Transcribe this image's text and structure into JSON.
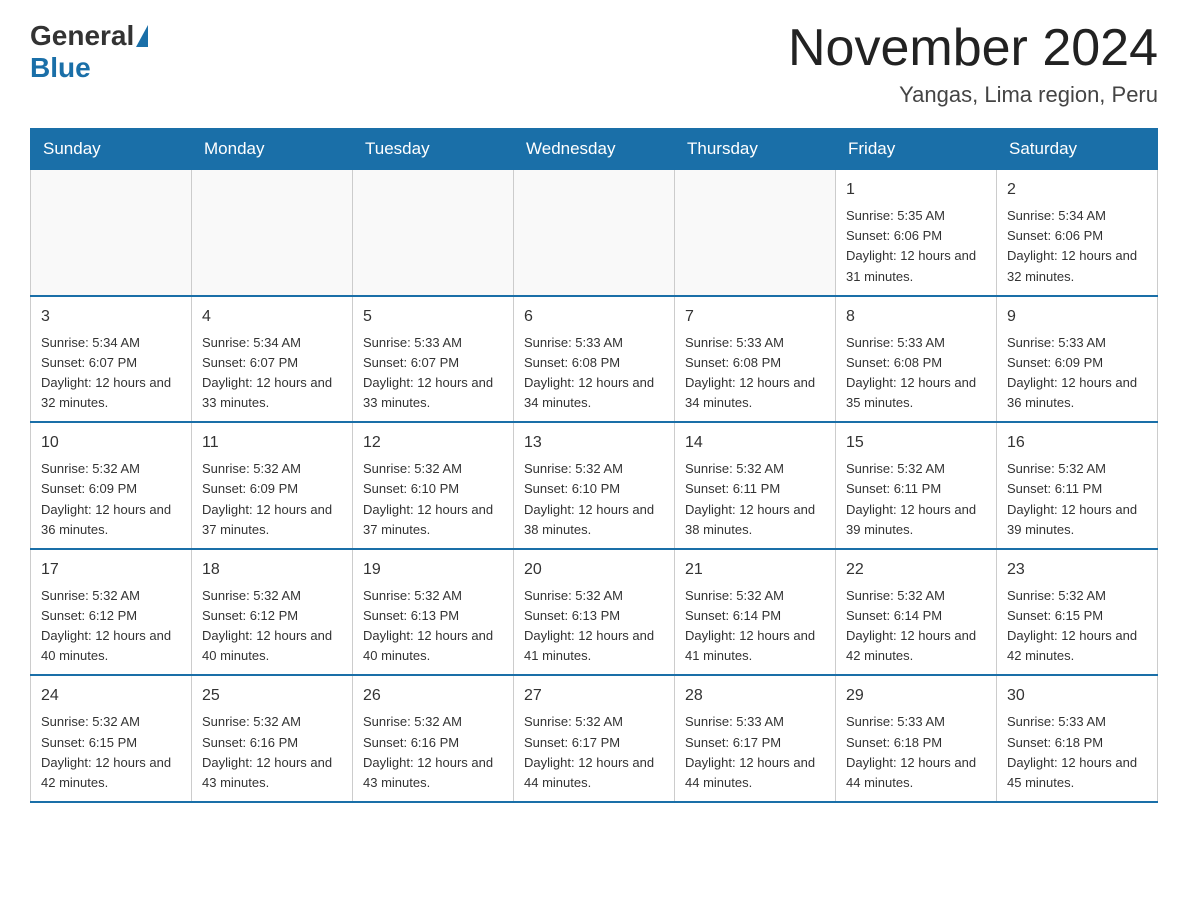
{
  "header": {
    "logo_general": "General",
    "logo_blue": "Blue",
    "title": "November 2024",
    "location": "Yangas, Lima region, Peru"
  },
  "weekdays": [
    "Sunday",
    "Monday",
    "Tuesday",
    "Wednesday",
    "Thursday",
    "Friday",
    "Saturday"
  ],
  "weeks": [
    [
      {
        "day": "",
        "info": ""
      },
      {
        "day": "",
        "info": ""
      },
      {
        "day": "",
        "info": ""
      },
      {
        "day": "",
        "info": ""
      },
      {
        "day": "",
        "info": ""
      },
      {
        "day": "1",
        "info": "Sunrise: 5:35 AM\nSunset: 6:06 PM\nDaylight: 12 hours and 31 minutes."
      },
      {
        "day": "2",
        "info": "Sunrise: 5:34 AM\nSunset: 6:06 PM\nDaylight: 12 hours and 32 minutes."
      }
    ],
    [
      {
        "day": "3",
        "info": "Sunrise: 5:34 AM\nSunset: 6:07 PM\nDaylight: 12 hours and 32 minutes."
      },
      {
        "day": "4",
        "info": "Sunrise: 5:34 AM\nSunset: 6:07 PM\nDaylight: 12 hours and 33 minutes."
      },
      {
        "day": "5",
        "info": "Sunrise: 5:33 AM\nSunset: 6:07 PM\nDaylight: 12 hours and 33 minutes."
      },
      {
        "day": "6",
        "info": "Sunrise: 5:33 AM\nSunset: 6:08 PM\nDaylight: 12 hours and 34 minutes."
      },
      {
        "day": "7",
        "info": "Sunrise: 5:33 AM\nSunset: 6:08 PM\nDaylight: 12 hours and 34 minutes."
      },
      {
        "day": "8",
        "info": "Sunrise: 5:33 AM\nSunset: 6:08 PM\nDaylight: 12 hours and 35 minutes."
      },
      {
        "day": "9",
        "info": "Sunrise: 5:33 AM\nSunset: 6:09 PM\nDaylight: 12 hours and 36 minutes."
      }
    ],
    [
      {
        "day": "10",
        "info": "Sunrise: 5:32 AM\nSunset: 6:09 PM\nDaylight: 12 hours and 36 minutes."
      },
      {
        "day": "11",
        "info": "Sunrise: 5:32 AM\nSunset: 6:09 PM\nDaylight: 12 hours and 37 minutes."
      },
      {
        "day": "12",
        "info": "Sunrise: 5:32 AM\nSunset: 6:10 PM\nDaylight: 12 hours and 37 minutes."
      },
      {
        "day": "13",
        "info": "Sunrise: 5:32 AM\nSunset: 6:10 PM\nDaylight: 12 hours and 38 minutes."
      },
      {
        "day": "14",
        "info": "Sunrise: 5:32 AM\nSunset: 6:11 PM\nDaylight: 12 hours and 38 minutes."
      },
      {
        "day": "15",
        "info": "Sunrise: 5:32 AM\nSunset: 6:11 PM\nDaylight: 12 hours and 39 minutes."
      },
      {
        "day": "16",
        "info": "Sunrise: 5:32 AM\nSunset: 6:11 PM\nDaylight: 12 hours and 39 minutes."
      }
    ],
    [
      {
        "day": "17",
        "info": "Sunrise: 5:32 AM\nSunset: 6:12 PM\nDaylight: 12 hours and 40 minutes."
      },
      {
        "day": "18",
        "info": "Sunrise: 5:32 AM\nSunset: 6:12 PM\nDaylight: 12 hours and 40 minutes."
      },
      {
        "day": "19",
        "info": "Sunrise: 5:32 AM\nSunset: 6:13 PM\nDaylight: 12 hours and 40 minutes."
      },
      {
        "day": "20",
        "info": "Sunrise: 5:32 AM\nSunset: 6:13 PM\nDaylight: 12 hours and 41 minutes."
      },
      {
        "day": "21",
        "info": "Sunrise: 5:32 AM\nSunset: 6:14 PM\nDaylight: 12 hours and 41 minutes."
      },
      {
        "day": "22",
        "info": "Sunrise: 5:32 AM\nSunset: 6:14 PM\nDaylight: 12 hours and 42 minutes."
      },
      {
        "day": "23",
        "info": "Sunrise: 5:32 AM\nSunset: 6:15 PM\nDaylight: 12 hours and 42 minutes."
      }
    ],
    [
      {
        "day": "24",
        "info": "Sunrise: 5:32 AM\nSunset: 6:15 PM\nDaylight: 12 hours and 42 minutes."
      },
      {
        "day": "25",
        "info": "Sunrise: 5:32 AM\nSunset: 6:16 PM\nDaylight: 12 hours and 43 minutes."
      },
      {
        "day": "26",
        "info": "Sunrise: 5:32 AM\nSunset: 6:16 PM\nDaylight: 12 hours and 43 minutes."
      },
      {
        "day": "27",
        "info": "Sunrise: 5:32 AM\nSunset: 6:17 PM\nDaylight: 12 hours and 44 minutes."
      },
      {
        "day": "28",
        "info": "Sunrise: 5:33 AM\nSunset: 6:17 PM\nDaylight: 12 hours and 44 minutes."
      },
      {
        "day": "29",
        "info": "Sunrise: 5:33 AM\nSunset: 6:18 PM\nDaylight: 12 hours and 44 minutes."
      },
      {
        "day": "30",
        "info": "Sunrise: 5:33 AM\nSunset: 6:18 PM\nDaylight: 12 hours and 45 minutes."
      }
    ]
  ]
}
